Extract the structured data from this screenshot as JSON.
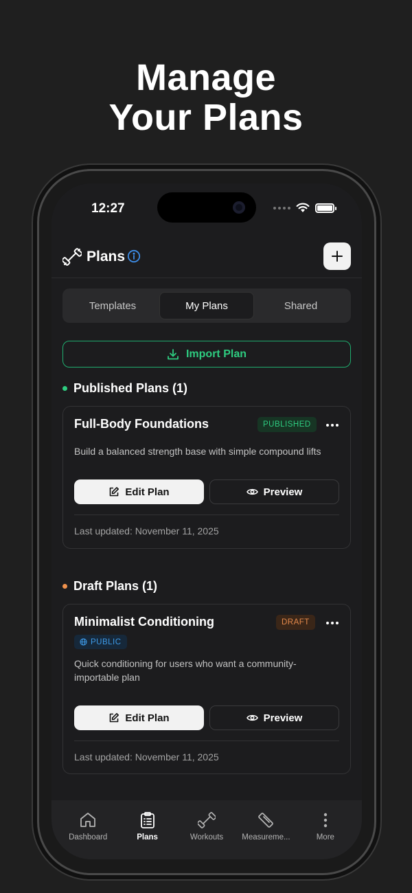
{
  "headline": {
    "line1": "Manage",
    "line2": "Your Plans"
  },
  "status_bar": {
    "time": "12:27"
  },
  "header": {
    "title": "Plans",
    "logo_icon": "dumbbell-icon",
    "info_icon": "info-icon",
    "add_icon": "plus-icon"
  },
  "tabs": [
    {
      "label": "Templates",
      "active": false
    },
    {
      "label": "My Plans",
      "active": true
    },
    {
      "label": "Shared",
      "active": false
    }
  ],
  "import_button": {
    "label": "Import Plan",
    "icon": "download-icon",
    "color": "#2ecc80"
  },
  "published_section": {
    "title": "Published Plans (1)",
    "dot_color": "#2ecc80",
    "plan": {
      "name": "Full-Body Foundations",
      "badge": "PUBLISHED",
      "description": "Build a balanced strength base with simple compound lifts",
      "edit_label": "Edit Plan",
      "preview_label": "Preview",
      "updated": "Last updated: November 11, 2025"
    }
  },
  "draft_section": {
    "title": "Draft Plans (1)",
    "dot_color": "#f0914c",
    "plan": {
      "name": "Minimalist Conditioning",
      "badge": "DRAFT",
      "visibility": "PUBLIC",
      "description": "Quick conditioning for users who want a community-importable plan",
      "edit_label": "Edit Plan",
      "preview_label": "Preview",
      "updated": "Last updated: November 11, 2025"
    }
  },
  "bottom_nav": [
    {
      "label": "Dashboard",
      "icon": "home-icon",
      "active": false
    },
    {
      "label": "Plans",
      "icon": "clipboard-icon",
      "active": true
    },
    {
      "label": "Workouts",
      "icon": "dumbbell-icon",
      "active": false
    },
    {
      "label": "Measureme...",
      "icon": "ruler-icon",
      "active": false
    },
    {
      "label": "More",
      "icon": "more-vertical-icon",
      "active": false
    }
  ]
}
